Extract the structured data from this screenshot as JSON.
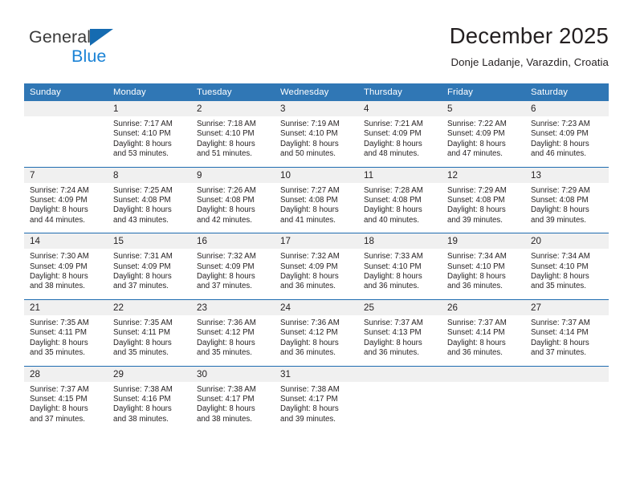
{
  "logo": {
    "word_one": "General",
    "word_two": "Blue",
    "triangle": "triangle-mark",
    "brand_blue": "#1b83d6",
    "brand_dark": "#3a3a3a"
  },
  "header": {
    "title": "December 2025",
    "subtitle": "Donje Ladanje, Varazdin, Croatia"
  },
  "theme": {
    "header_bg": "#3077b5",
    "header_text": "#ffffff",
    "daynum_bg": "#f0f0f0",
    "week_divider": "#1f6cb0",
    "body_text": "#231f20"
  },
  "calendar": {
    "weekday_headers": [
      "Sunday",
      "Monday",
      "Tuesday",
      "Wednesday",
      "Thursday",
      "Friday",
      "Saturday"
    ],
    "weeks": [
      [
        {
          "day": "",
          "sunrise": "",
          "sunset": "",
          "daylight_1": "",
          "daylight_2": ""
        },
        {
          "day": "1",
          "sunrise": "Sunrise: 7:17 AM",
          "sunset": "Sunset: 4:10 PM",
          "daylight_1": "Daylight: 8 hours",
          "daylight_2": "and 53 minutes."
        },
        {
          "day": "2",
          "sunrise": "Sunrise: 7:18 AM",
          "sunset": "Sunset: 4:10 PM",
          "daylight_1": "Daylight: 8 hours",
          "daylight_2": "and 51 minutes."
        },
        {
          "day": "3",
          "sunrise": "Sunrise: 7:19 AM",
          "sunset": "Sunset: 4:10 PM",
          "daylight_1": "Daylight: 8 hours",
          "daylight_2": "and 50 minutes."
        },
        {
          "day": "4",
          "sunrise": "Sunrise: 7:21 AM",
          "sunset": "Sunset: 4:09 PM",
          "daylight_1": "Daylight: 8 hours",
          "daylight_2": "and 48 minutes."
        },
        {
          "day": "5",
          "sunrise": "Sunrise: 7:22 AM",
          "sunset": "Sunset: 4:09 PM",
          "daylight_1": "Daylight: 8 hours",
          "daylight_2": "and 47 minutes."
        },
        {
          "day": "6",
          "sunrise": "Sunrise: 7:23 AM",
          "sunset": "Sunset: 4:09 PM",
          "daylight_1": "Daylight: 8 hours",
          "daylight_2": "and 46 minutes."
        }
      ],
      [
        {
          "day": "7",
          "sunrise": "Sunrise: 7:24 AM",
          "sunset": "Sunset: 4:09 PM",
          "daylight_1": "Daylight: 8 hours",
          "daylight_2": "and 44 minutes."
        },
        {
          "day": "8",
          "sunrise": "Sunrise: 7:25 AM",
          "sunset": "Sunset: 4:08 PM",
          "daylight_1": "Daylight: 8 hours",
          "daylight_2": "and 43 minutes."
        },
        {
          "day": "9",
          "sunrise": "Sunrise: 7:26 AM",
          "sunset": "Sunset: 4:08 PM",
          "daylight_1": "Daylight: 8 hours",
          "daylight_2": "and 42 minutes."
        },
        {
          "day": "10",
          "sunrise": "Sunrise: 7:27 AM",
          "sunset": "Sunset: 4:08 PM",
          "daylight_1": "Daylight: 8 hours",
          "daylight_2": "and 41 minutes."
        },
        {
          "day": "11",
          "sunrise": "Sunrise: 7:28 AM",
          "sunset": "Sunset: 4:08 PM",
          "daylight_1": "Daylight: 8 hours",
          "daylight_2": "and 40 minutes."
        },
        {
          "day": "12",
          "sunrise": "Sunrise: 7:29 AM",
          "sunset": "Sunset: 4:08 PM",
          "daylight_1": "Daylight: 8 hours",
          "daylight_2": "and 39 minutes."
        },
        {
          "day": "13",
          "sunrise": "Sunrise: 7:29 AM",
          "sunset": "Sunset: 4:08 PM",
          "daylight_1": "Daylight: 8 hours",
          "daylight_2": "and 39 minutes."
        }
      ],
      [
        {
          "day": "14",
          "sunrise": "Sunrise: 7:30 AM",
          "sunset": "Sunset: 4:09 PM",
          "daylight_1": "Daylight: 8 hours",
          "daylight_2": "and 38 minutes."
        },
        {
          "day": "15",
          "sunrise": "Sunrise: 7:31 AM",
          "sunset": "Sunset: 4:09 PM",
          "daylight_1": "Daylight: 8 hours",
          "daylight_2": "and 37 minutes."
        },
        {
          "day": "16",
          "sunrise": "Sunrise: 7:32 AM",
          "sunset": "Sunset: 4:09 PM",
          "daylight_1": "Daylight: 8 hours",
          "daylight_2": "and 37 minutes."
        },
        {
          "day": "17",
          "sunrise": "Sunrise: 7:32 AM",
          "sunset": "Sunset: 4:09 PM",
          "daylight_1": "Daylight: 8 hours",
          "daylight_2": "and 36 minutes."
        },
        {
          "day": "18",
          "sunrise": "Sunrise: 7:33 AM",
          "sunset": "Sunset: 4:10 PM",
          "daylight_1": "Daylight: 8 hours",
          "daylight_2": "and 36 minutes."
        },
        {
          "day": "19",
          "sunrise": "Sunrise: 7:34 AM",
          "sunset": "Sunset: 4:10 PM",
          "daylight_1": "Daylight: 8 hours",
          "daylight_2": "and 36 minutes."
        },
        {
          "day": "20",
          "sunrise": "Sunrise: 7:34 AM",
          "sunset": "Sunset: 4:10 PM",
          "daylight_1": "Daylight: 8 hours",
          "daylight_2": "and 35 minutes."
        }
      ],
      [
        {
          "day": "21",
          "sunrise": "Sunrise: 7:35 AM",
          "sunset": "Sunset: 4:11 PM",
          "daylight_1": "Daylight: 8 hours",
          "daylight_2": "and 35 minutes."
        },
        {
          "day": "22",
          "sunrise": "Sunrise: 7:35 AM",
          "sunset": "Sunset: 4:11 PM",
          "daylight_1": "Daylight: 8 hours",
          "daylight_2": "and 35 minutes."
        },
        {
          "day": "23",
          "sunrise": "Sunrise: 7:36 AM",
          "sunset": "Sunset: 4:12 PM",
          "daylight_1": "Daylight: 8 hours",
          "daylight_2": "and 35 minutes."
        },
        {
          "day": "24",
          "sunrise": "Sunrise: 7:36 AM",
          "sunset": "Sunset: 4:12 PM",
          "daylight_1": "Daylight: 8 hours",
          "daylight_2": "and 36 minutes."
        },
        {
          "day": "25",
          "sunrise": "Sunrise: 7:37 AM",
          "sunset": "Sunset: 4:13 PM",
          "daylight_1": "Daylight: 8 hours",
          "daylight_2": "and 36 minutes."
        },
        {
          "day": "26",
          "sunrise": "Sunrise: 7:37 AM",
          "sunset": "Sunset: 4:14 PM",
          "daylight_1": "Daylight: 8 hours",
          "daylight_2": "and 36 minutes."
        },
        {
          "day": "27",
          "sunrise": "Sunrise: 7:37 AM",
          "sunset": "Sunset: 4:14 PM",
          "daylight_1": "Daylight: 8 hours",
          "daylight_2": "and 37 minutes."
        }
      ],
      [
        {
          "day": "28",
          "sunrise": "Sunrise: 7:37 AM",
          "sunset": "Sunset: 4:15 PM",
          "daylight_1": "Daylight: 8 hours",
          "daylight_2": "and 37 minutes."
        },
        {
          "day": "29",
          "sunrise": "Sunrise: 7:38 AM",
          "sunset": "Sunset: 4:16 PM",
          "daylight_1": "Daylight: 8 hours",
          "daylight_2": "and 38 minutes."
        },
        {
          "day": "30",
          "sunrise": "Sunrise: 7:38 AM",
          "sunset": "Sunset: 4:17 PM",
          "daylight_1": "Daylight: 8 hours",
          "daylight_2": "and 38 minutes."
        },
        {
          "day": "31",
          "sunrise": "Sunrise: 7:38 AM",
          "sunset": "Sunset: 4:17 PM",
          "daylight_1": "Daylight: 8 hours",
          "daylight_2": "and 39 minutes."
        },
        {
          "day": "",
          "sunrise": "",
          "sunset": "",
          "daylight_1": "",
          "daylight_2": ""
        },
        {
          "day": "",
          "sunrise": "",
          "sunset": "",
          "daylight_1": "",
          "daylight_2": ""
        },
        {
          "day": "",
          "sunrise": "",
          "sunset": "",
          "daylight_1": "",
          "daylight_2": ""
        }
      ]
    ]
  }
}
